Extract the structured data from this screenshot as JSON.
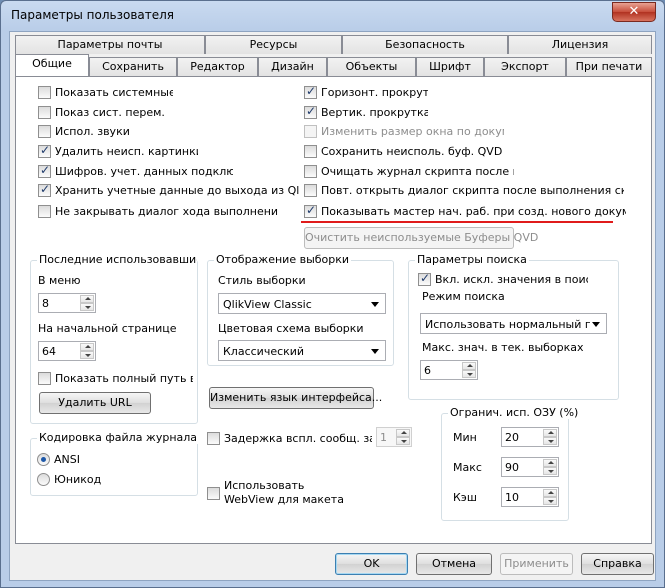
{
  "window": {
    "title": "Параметры пользователя",
    "close_glyph": "✕"
  },
  "tabs_row1": [
    "Параметры почты",
    "Ресурсы",
    "Безопасность",
    "Лицензия"
  ],
  "tabs_row2": [
    "Общие",
    "Сохранить",
    "Редактор",
    "Дизайн",
    "Объекты",
    "Шрифт",
    "Экспорт",
    "При печати"
  ],
  "active_tab": "Общие",
  "left_checks": [
    {
      "label": "Показать системные",
      "checked": false
    },
    {
      "label": "Показ сист. перем.",
      "checked": false
    },
    {
      "label": "Испол. звуки",
      "checked": false
    },
    {
      "label": "Удалить неисп. картинки",
      "checked": true
    },
    {
      "label": "Шифров. учет. данных подключ. по",
      "checked": true
    },
    {
      "label": "Хранить учетные данные до выхода из QlikView",
      "checked": true
    },
    {
      "label": "Не закрывать диалог хода выполнения по",
      "checked": false
    }
  ],
  "right_checks": [
    {
      "label": "Горизонт. прокрутка",
      "checked": true,
      "disabled": false
    },
    {
      "label": "Вертик. прокрутка",
      "checked": true,
      "disabled": false
    },
    {
      "label": "Изменить размер окна по документ",
      "checked": false,
      "disabled": true
    },
    {
      "label": "Сохранить неисполь. буф. QVD",
      "checked": false,
      "disabled": false
    },
    {
      "label": "Очищать журнал скрипта после кажд",
      "checked": false,
      "disabled": false
    },
    {
      "label": "Повт. открыть диалог скрипта после выполнения скрипт",
      "checked": false,
      "disabled": false
    },
    {
      "label": "Показывать мастер нач. раб. при созд. нового документа",
      "checked": true,
      "disabled": false
    }
  ],
  "clear_qvd_button": "Очистить неиспользуемые Буферы QVD",
  "recent": {
    "title": "Последние использовавшиеся фа",
    "in_menu_label": "В меню",
    "in_menu_value": "8",
    "start_page_label": "На начальной странице",
    "start_page_value": "64",
    "full_path_label": "Показать полный путь в",
    "full_path_checked": false,
    "delete_url_button": "Удалить URL"
  },
  "selection": {
    "title": "Отображение выборки",
    "style_label": "Стиль выборки",
    "style_value": "QlikView Classic",
    "scheme_label": "Цветовая схема выборки",
    "scheme_value": "Классический"
  },
  "change_lang_button": "Изменить язык интерфейса...",
  "search": {
    "title": "Параметры поиска",
    "include_label": "Вкл. искл. значения в поиск",
    "include_checked": true,
    "mode_label": "Режим поиска",
    "mode_value": "Использовать нормальный пои",
    "max_label": "Макс. знач. в тек. выборках",
    "max_value": "6"
  },
  "encoding": {
    "title": "Кодировка файла журнала",
    "options": [
      "ANSI",
      "Юникод"
    ],
    "selected": "ANSI"
  },
  "tooltip_delay": {
    "label": "Задержка вспл. сообщ. закл",
    "checked": false,
    "value": "1"
  },
  "webview": {
    "label_line1": "Использовать",
    "label_line2": "WebView для макета",
    "checked": false
  },
  "ram": {
    "title": "Огранич. исп. ОЗУ (%)",
    "min_label": "Мин",
    "min_value": "20",
    "max_label": "Макс",
    "max_value": "90",
    "cache_label": "Кэш",
    "cache_value": "10"
  },
  "footer": {
    "ok": "OK",
    "cancel": "Отмена",
    "apply": "Применить",
    "help": "Справка"
  },
  "colors": {
    "highlight_underline": "#e01b1b",
    "titlebar": "#b9cde8"
  }
}
